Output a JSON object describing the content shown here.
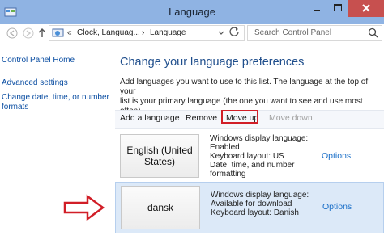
{
  "window": {
    "title": "Language"
  },
  "address": {
    "root": "«",
    "crumbs": [
      "Clock, Languag...",
      "Language"
    ],
    "separator": "›"
  },
  "search": {
    "placeholder": "Search Control Panel"
  },
  "sidebar": {
    "items": [
      {
        "label": "Control Panel Home"
      },
      {
        "label": "Advanced settings"
      },
      {
        "label": "Change date, time, or number"
      },
      {
        "label": "formats"
      }
    ]
  },
  "main": {
    "heading": "Change your language preferences",
    "description_line1": "Add languages you want to use to this list. The language at the top of your",
    "description_line2": "list is your primary language (the one you want to see and use most often)."
  },
  "toolbar": {
    "add": "Add a language",
    "remove": "Remove",
    "move_up": "Move up",
    "move_down": "Move down"
  },
  "languages": [
    {
      "name_line1": "English (United",
      "name_line2": "States)",
      "details": [
        "Windows display language:",
        "Enabled",
        "Keyboard layout: US",
        "Date, time, and number",
        "formatting"
      ],
      "options": "Options"
    },
    {
      "name_line1": "dansk",
      "name_line2": "",
      "details": [
        "Windows display language:",
        "Available for download",
        "Keyboard layout: Danish"
      ],
      "options": "Options"
    }
  ],
  "colors": {
    "titlebar": "#8fb3e3",
    "close": "#c7504f",
    "link": "#0b4ea2",
    "heading": "#1f4e8c",
    "highlight_outline": "#d11e27",
    "selected_row": "#dce9f8"
  },
  "icons": [
    "app-icon",
    "back-icon",
    "forward-icon",
    "up-icon",
    "refresh-icon",
    "search-icon",
    "pointer-arrow-icon"
  ]
}
